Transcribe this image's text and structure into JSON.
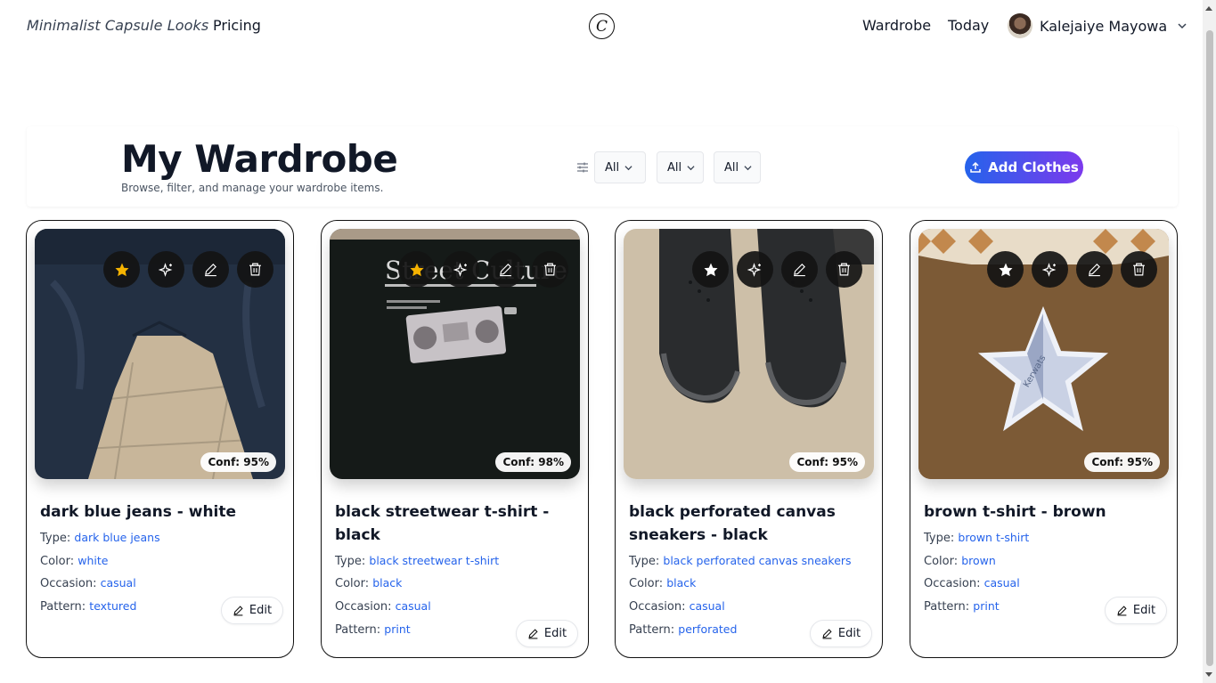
{
  "header": {
    "brand": "Minimalist Capsule Looks",
    "pricing": "Pricing",
    "logo_letter": "C",
    "wardrobe": "Wardrobe",
    "today": "Today",
    "user_name": "Kalejaiye Mayowa"
  },
  "toolbar": {
    "title": "My Wardrobe",
    "subtitle": "Browse, filter, and manage your wardrobe items.",
    "filters": [
      "All",
      "All",
      "All"
    ],
    "add_label": "Add Clothes"
  },
  "labels": {
    "type": "Type:",
    "color": "Color:",
    "occasion": "Occasion:",
    "pattern": "Pattern:",
    "edit": "Edit"
  },
  "items": [
    {
      "title": "dark blue jeans - white",
      "type": "dark blue jeans",
      "color": "white",
      "occasion": "casual",
      "pattern": "textured",
      "conf": "Conf: 95%",
      "favorite": true
    },
    {
      "title": "black streetwear t-shirt - black",
      "type": "black streetwear t-shirt",
      "color": "black",
      "occasion": "casual",
      "pattern": "print",
      "conf": "Conf: 98%",
      "favorite": true
    },
    {
      "title": "black perforated canvas sneakers - black",
      "type": "black perforated canvas sneakers",
      "color": "black",
      "occasion": "casual",
      "pattern": "perforated",
      "conf": "Conf: 95%",
      "favorite": false
    },
    {
      "title": "brown t-shirt - brown",
      "type": "brown t-shirt",
      "color": "brown",
      "occasion": "casual",
      "pattern": "print",
      "conf": "Conf: 95%",
      "favorite": false
    }
  ],
  "icons": {
    "favorite_active": "star-filled-icon",
    "favorite_inactive": "star-icon",
    "ai": "sparkles-icon",
    "edit": "pencil-icon",
    "delete": "trash-icon",
    "filter": "sliders-icon",
    "upload": "upload-icon"
  },
  "colors": {
    "accent_start": "#2563eb",
    "accent_end": "#7c3aed",
    "link": "#2563eb",
    "star_active": "#f5b301"
  }
}
